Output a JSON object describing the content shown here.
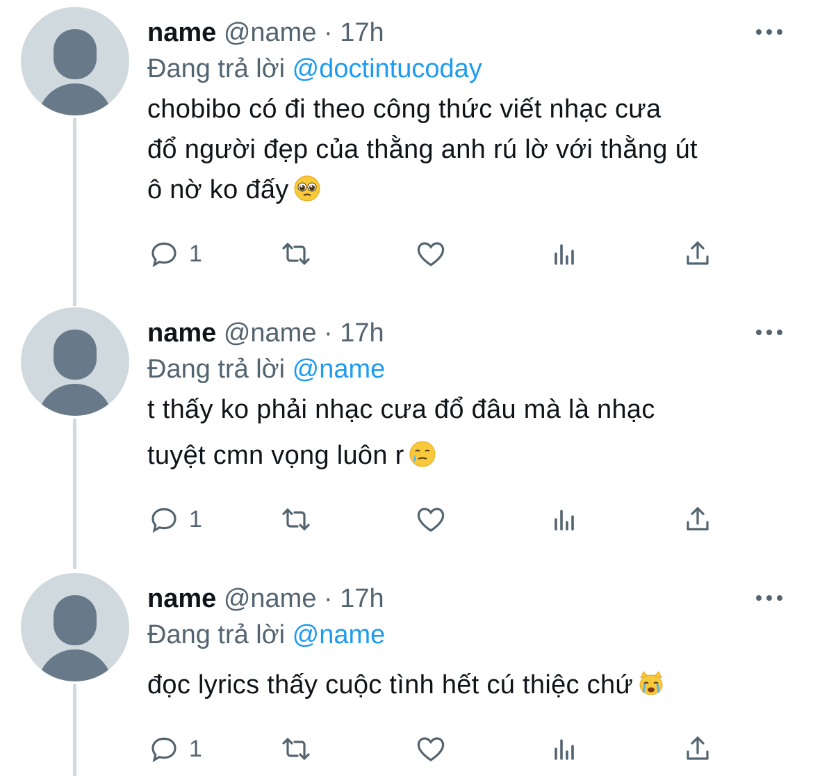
{
  "colors": {
    "accent": "#1d9bf0",
    "secondary_text": "#536471",
    "primary_text": "#0f1419",
    "thread_line": "#cfd9de"
  },
  "tweets": [
    {
      "name": "name",
      "handle": "@name",
      "dot": "·",
      "time": "17h",
      "reply_prefix": "Đang trả lời",
      "reply_to": "@doctintucoday",
      "lines": [
        "chobibo có đi theo công thức viết nhạc cưa",
        "đổ người đẹp của thằng anh rú lờ với thằng út",
        "ô nờ ko đấy"
      ],
      "emoji": "pleading-face-emoji",
      "reply_count": "1"
    },
    {
      "name": "name",
      "handle": "@name",
      "dot": "·",
      "time": "17h",
      "reply_prefix": "Đang trả lời",
      "reply_to": "@name",
      "lines": [
        "t thấy ko phải nhạc cưa đổ đâu mà là nhạc",
        "tuyệt cmn vọng luôn r"
      ],
      "emoji": "smiling-face-with-tear-emoji",
      "reply_count": "1"
    },
    {
      "name": "name",
      "handle": "@name",
      "dot": "·",
      "time": "17h",
      "reply_prefix": "Đang trả lời",
      "reply_to": "@name",
      "lines": [
        "đọc lyrics thấy cuộc tình hết cú thiệc chứ"
      ],
      "emoji": "crying-cat-emoji",
      "reply_count": "1"
    }
  ]
}
